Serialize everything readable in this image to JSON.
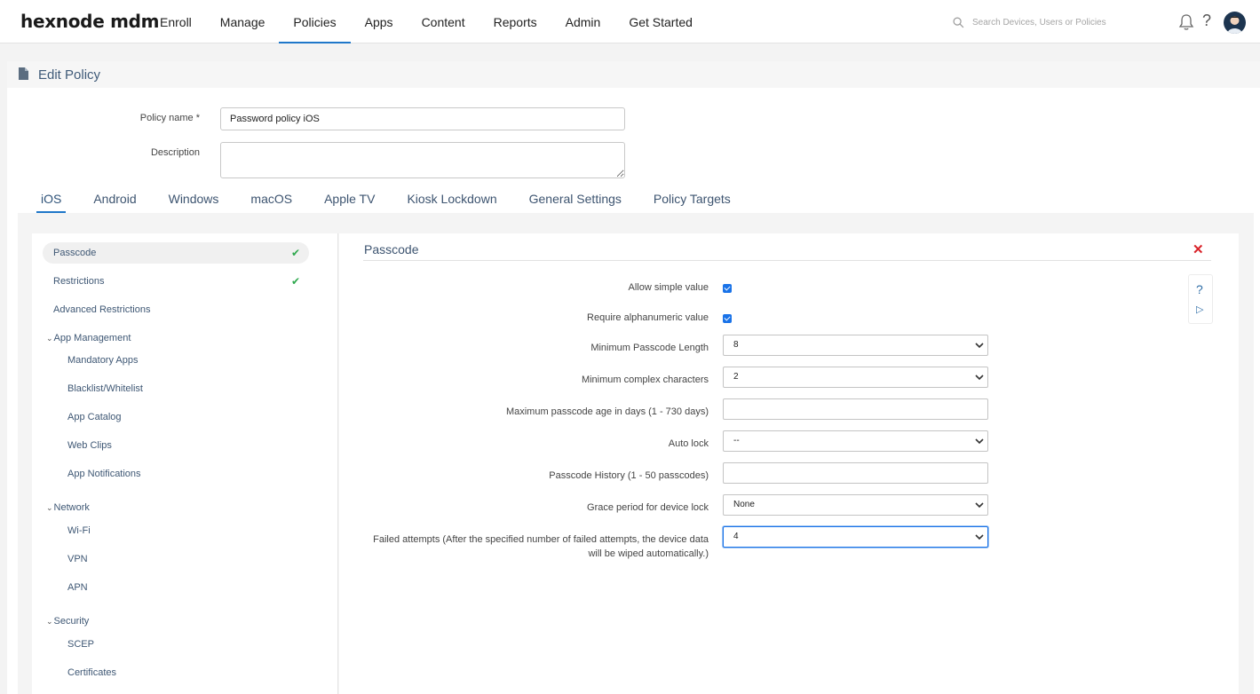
{
  "header": {
    "logo": "hexnode mdm",
    "nav": [
      "Enroll",
      "Manage",
      "Policies",
      "Apps",
      "Content",
      "Reports",
      "Admin",
      "Get Started"
    ],
    "active_nav": "Policies",
    "search_placeholder": "Search Devices, Users or Policies",
    "help": "?"
  },
  "page": {
    "title": "Edit Policy",
    "policy_name_label": "Policy name *",
    "policy_name_value": "Password policy iOS",
    "description_label": "Description",
    "description_value": ""
  },
  "os_tabs": [
    "iOS",
    "Android",
    "Windows",
    "macOS",
    "Apple TV",
    "Kiosk Lockdown",
    "General Settings",
    "Policy Targets"
  ],
  "active_os_tab": "iOS",
  "sidebar": {
    "passcode": "Passcode",
    "restrictions": "Restrictions",
    "advanced_restrictions": "Advanced Restrictions",
    "app_management": "App Management",
    "mandatory_apps": "Mandatory Apps",
    "blacklist_whitelist": "Blacklist/Whitelist",
    "app_catalog": "App Catalog",
    "web_clips": "Web Clips",
    "app_notifications": "App Notifications",
    "network": "Network",
    "wifi": "Wi-Fi",
    "vpn": "VPN",
    "apn": "APN",
    "security": "Security",
    "scep": "SCEP",
    "certificates": "Certificates",
    "check": "✔",
    "caret": "⌄"
  },
  "passcode": {
    "title": "Passcode",
    "close": "✕",
    "tool_help": "?",
    "tool_play": "▷",
    "allow_simple_label": "Allow simple value",
    "allow_simple_checked": true,
    "require_alnum_label": "Require alphanumeric value",
    "require_alnum_checked": true,
    "min_length_label": "Minimum Passcode Length",
    "min_length_value": "8",
    "min_complex_label": "Minimum complex characters",
    "min_complex_value": "2",
    "max_age_label": "Maximum passcode age in days (1 - 730 days)",
    "max_age_value": "",
    "auto_lock_label": "Auto lock",
    "auto_lock_value": "--",
    "history_label": "Passcode History (1 - 50 passcodes)",
    "history_value": "",
    "grace_label": "Grace period for device lock",
    "grace_value": "None",
    "failed_label_1": "Failed attempts (After the specified number of failed attempts, the device data",
    "failed_label_2": "will be wiped automatically.)",
    "failed_value": "4"
  },
  "colors": {
    "accent": "#1f77c9",
    "check_green": "#2ea84d",
    "close_red": "#d9232a",
    "link_text": "#3e5774"
  }
}
